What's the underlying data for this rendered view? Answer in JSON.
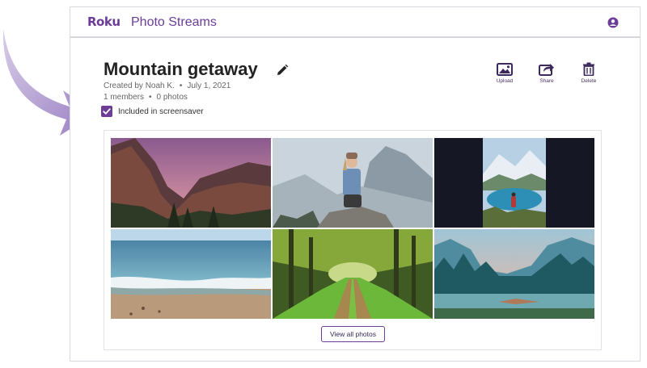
{
  "header": {
    "brand": "Roku",
    "app_title": "Photo Streams",
    "account_icon": "user-circle-icon"
  },
  "album": {
    "title": "Mountain getaway",
    "created_by": "Created by Noah K.",
    "created_date": "July 1, 2021",
    "members": "1 members",
    "photos": "0 photos",
    "separator": "•"
  },
  "screensaver": {
    "label": "Included in screensaver",
    "checked": true
  },
  "actions": {
    "upload": "Upload",
    "share": "Share",
    "delete": "Delete"
  },
  "gallery": {
    "photos": [
      {
        "subject": "valley-cliffs-at-dusk"
      },
      {
        "subject": "woman-on-rock-with-mountains"
      },
      {
        "subject": "hiker-by-alpine-lake"
      },
      {
        "subject": "ocean-beach-waves"
      },
      {
        "subject": "forest-path"
      },
      {
        "subject": "lake-with-pine-trees"
      }
    ],
    "view_all_label": "View all photos"
  },
  "colors": {
    "accent": "#6c3c97",
    "arrow": "#a58cc8"
  }
}
